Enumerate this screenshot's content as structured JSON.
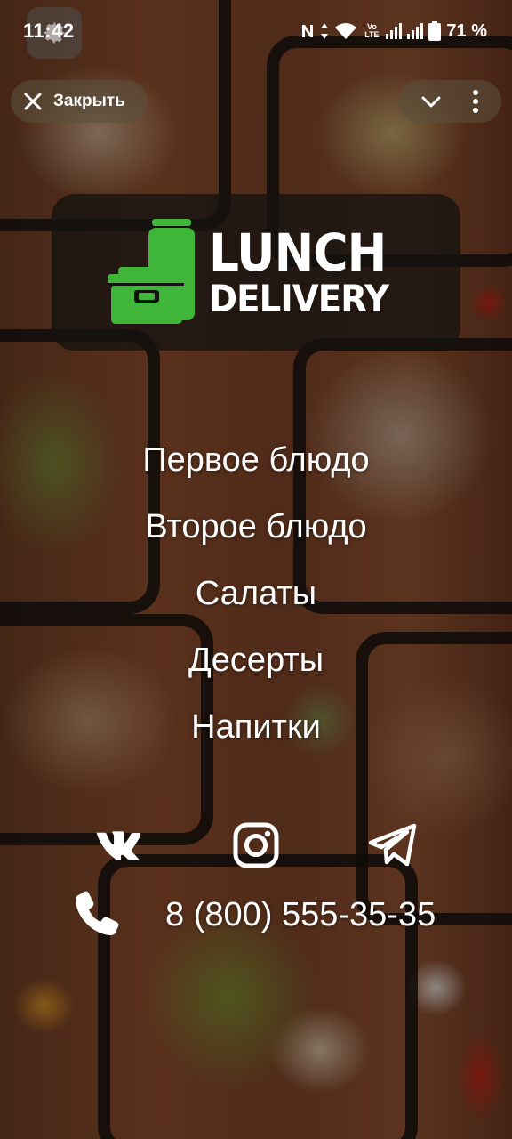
{
  "status_bar": {
    "time": "11:42",
    "network_label": "Vo LTE",
    "battery": "71 %",
    "icons": [
      "nfc-icon",
      "data-arrows-icon",
      "wifi-icon",
      "signal-icon",
      "signal-icon",
      "battery-icon"
    ]
  },
  "topbar": {
    "close_label": "Закрыть",
    "close_icon": "close-icon",
    "collapse_icon": "chevron-down-icon",
    "more_icon": "more-vertical-icon"
  },
  "logo": {
    "line1": "LUNCH",
    "line2": "DELIVERY",
    "color": "#3fb63a"
  },
  "menu": {
    "items": [
      {
        "label": "Первое блюдо"
      },
      {
        "label": "Второе блюдо"
      },
      {
        "label": "Салаты"
      },
      {
        "label": "Десерты"
      },
      {
        "label": "Напитки"
      }
    ]
  },
  "socials": [
    {
      "icon": "vk-icon"
    },
    {
      "icon": "instagram-icon"
    },
    {
      "icon": "telegram-icon"
    }
  ],
  "contact": {
    "phone_icon": "phone-icon",
    "phone": "8 (800) 555-35-35"
  }
}
